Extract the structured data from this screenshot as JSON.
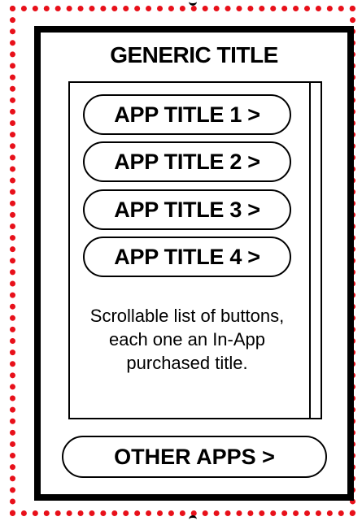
{
  "screen": {
    "title": "GENERIC TITLE",
    "app_list": [
      {
        "label": "APP TITLE 1 >"
      },
      {
        "label": "APP TITLE 2 >"
      },
      {
        "label": "APP TITLE 3 >"
      },
      {
        "label": "APP TITLE 4 >"
      }
    ],
    "note": "Scrollable list of buttons, each one an In-App purchased title.",
    "other_apps_label": "OTHER APPS >"
  },
  "colors": {
    "frame_dots": "#e8101a",
    "outline": "#000000",
    "background": "#ffffff"
  }
}
